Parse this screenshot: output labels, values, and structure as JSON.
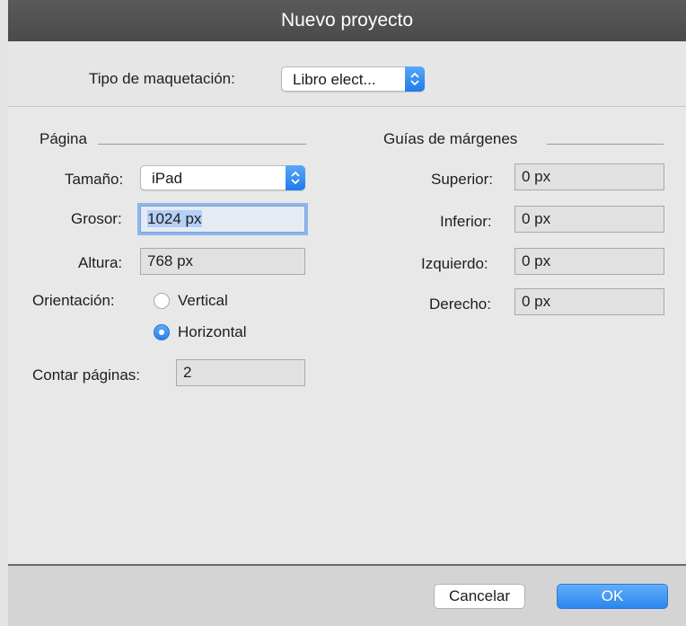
{
  "window": {
    "title": "Nuevo proyecto"
  },
  "layout_type": {
    "label": "Tipo de maquetación:",
    "value": "Libro elect..."
  },
  "page": {
    "section_title": "Página",
    "size_label": "Tamaño:",
    "size_value": "iPad",
    "width_label": "Grosor:",
    "width_value": "1024 px",
    "height_label": "Altura:",
    "height_value": "768 px",
    "orientation_label": "Orientación:",
    "orientation_options": [
      "Vertical",
      "Horizontal"
    ],
    "orientation_selected": "Horizontal",
    "page_count_label": "Contar páginas:",
    "page_count_value": "2"
  },
  "margins": {
    "section_title": "Guías de márgenes",
    "top_label": "Superior:",
    "top_value": "0 px",
    "bottom_label": "Inferior:",
    "bottom_value": "0 px",
    "left_label": "Izquierdo:",
    "left_value": "0 px",
    "right_label": "Derecho:",
    "right_value": "0 px"
  },
  "buttons": {
    "cancel": "Cancelar",
    "ok": "OK"
  },
  "colors": {
    "accent": "#2a86ee",
    "titlebar": "#505050"
  },
  "icons": {
    "popup_arrow": "up-down-chevron-icon"
  }
}
